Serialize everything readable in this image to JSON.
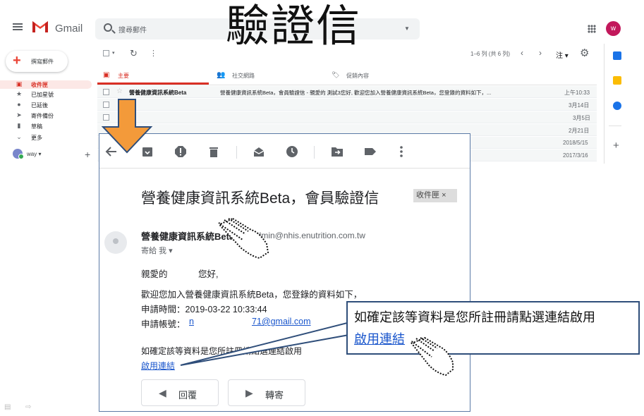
{
  "header": {
    "app_name": "Gmail",
    "search_placeholder": "搜尋郵件",
    "overlay_title": "驗證信",
    "avatar_letter": "w"
  },
  "sidebar": {
    "compose_label": "撰寫郵件",
    "items": [
      {
        "label": "收件匣",
        "icon": "inbox-icon",
        "active": true
      },
      {
        "label": "已加星號",
        "icon": "star-icon"
      },
      {
        "label": "已延後",
        "icon": "clock-icon"
      },
      {
        "label": "寄件備份",
        "icon": "send-icon"
      },
      {
        "label": "草稿",
        "icon": "draft-icon"
      },
      {
        "label": "更多",
        "icon": "chevron-down-icon"
      }
    ],
    "user_name": "way"
  },
  "list_toolbar": {
    "pagination": "1–6 列 (共 6 列)",
    "lang_button": "注"
  },
  "tabs": [
    {
      "label": "主要",
      "active": true
    },
    {
      "label": "社交網路"
    },
    {
      "label": "促銷內容"
    }
  ],
  "rows": [
    {
      "sender": "營養健康資訊系統Beta",
      "snippet": "營養健康資訊系統Beta，會員驗證信 - 親愛的 測試3您好, 歡迎您加入營養健康資訊系統Beta，您登錄的資料如下，...",
      "date": "上午10:33"
    },
    {
      "sender": "",
      "snippet": "",
      "date": "3月14日"
    },
    {
      "sender": "",
      "snippet": "",
      "date": "3月5日"
    },
    {
      "sender": "",
      "snippet": "",
      "date": "2月21日"
    },
    {
      "sender": "",
      "snippet": "",
      "date": "2018/5/15"
    },
    {
      "sender": "",
      "snippet": "",
      "date": "2017/3/16"
    }
  ],
  "message": {
    "subject": "營養健康資訊系統Beta，會員驗證信",
    "label_chip": "收件匣",
    "sender_name": "營養健康資訊系統Beta",
    "sender_email": "admin@nhis.enutrition.com.tw",
    "to_line": "寄給 我 ▾",
    "greeting_prefix": "親愛的",
    "greeting_suffix": "您好,",
    "welcome_line": "歡迎您加入營養健康資訊系統Beta，您登錄的資料如下，",
    "apply_time": "申請時間：2019-03-22 10:33:44",
    "account_label": "申請帳號：",
    "account_email_start": "n",
    "account_email_end": "71@gmail.com",
    "confirm_text": "如確定該等資料是您所註冊請點選連結啟用",
    "activate_link": "啟用連結",
    "reply_label": "回覆",
    "forward_label": "轉寄"
  },
  "callout": {
    "text": "如確定該等資料是您所註冊請點選連結啟用",
    "link": "啟用連結"
  },
  "colors": {
    "accent_red": "#d93025",
    "link_blue": "#1a56cc",
    "callout_border": "#2f4e7a",
    "arrow_orange": "#f39a3a"
  }
}
